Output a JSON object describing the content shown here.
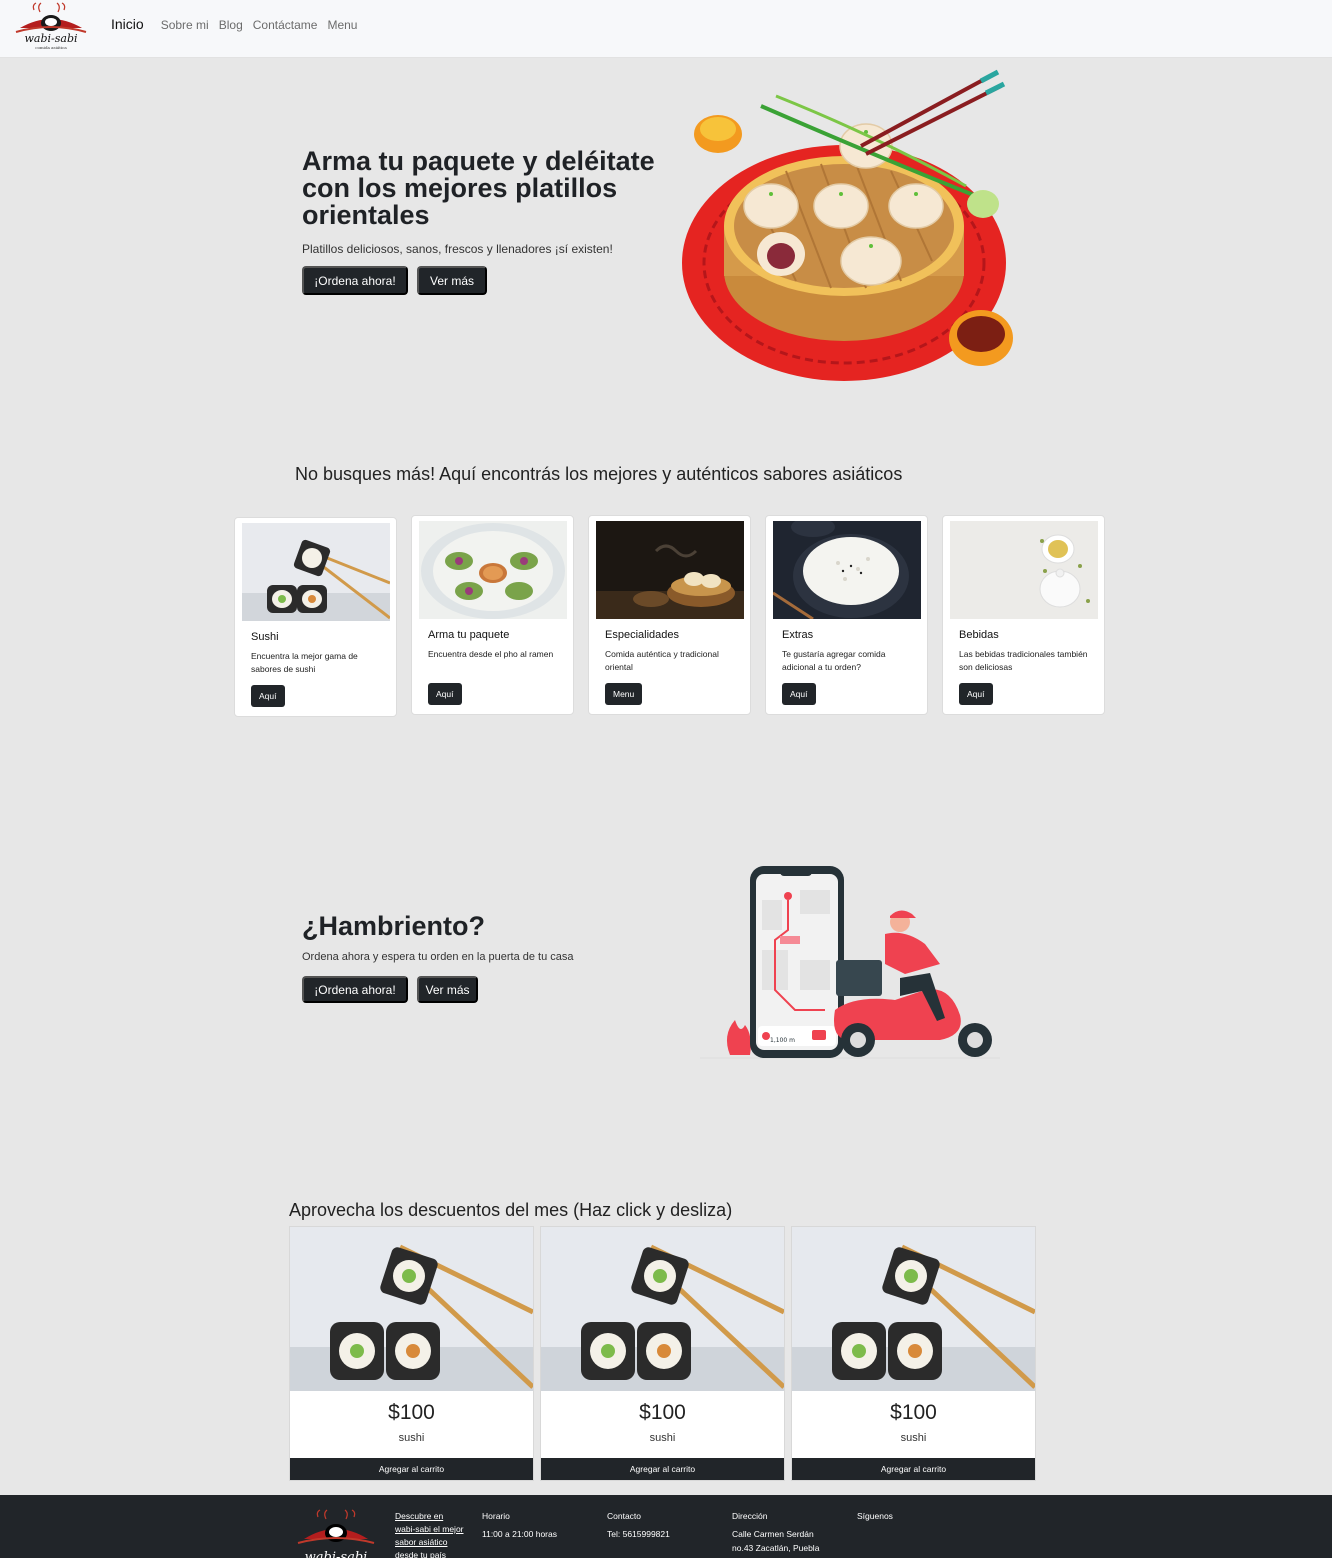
{
  "nav": {
    "logo_text": "wabi-sabi",
    "logo_sub": "comida asiática",
    "links": [
      "Inicio",
      "Sobre mi",
      "Blog",
      "Contáctame",
      "Menu"
    ]
  },
  "hero": {
    "title": "Arma tu paquete y deléitate con los mejores platillos orientales",
    "subtitle": "Platillos deliciosos, sanos, frescos y llenadores ¡sí existen!",
    "order_button": "¡Ordena ahora!",
    "more_button": "Ver más"
  },
  "categories": {
    "title": "No busques más! Aquí encontrás los mejores y auténticos sabores asiáticos",
    "cards": [
      {
        "title": "Sushi",
        "text": "Encuentra la mejor gama de sabores de sushi",
        "button": "Aquí"
      },
      {
        "title": "Arma tu paquete",
        "text": "Encuentra desde el pho al ramen",
        "button": "Aquí"
      },
      {
        "title": "Especialidades",
        "text": "Comida auténtica y tradicional oriental",
        "button": "Menu"
      },
      {
        "title": "Extras",
        "text": "Te gustaría agregar comida adicional a tu orden?",
        "button": "Aquí"
      },
      {
        "title": "Bebidas",
        "text": "Las bebidas tradicionales también son deliciosas",
        "button": "Aquí"
      }
    ]
  },
  "hungry": {
    "title": "¿Hambriento?",
    "subtitle": "Ordena ahora y espera tu orden en la puerta de tu casa",
    "order_button": "¡Ordena ahora!",
    "more_button": "Ver más",
    "phone_distance": "1,100 m"
  },
  "deals": {
    "title": "Aprovecha los descuentos del mes (Haz click y desliza)",
    "items": [
      {
        "price": "$100",
        "name": "sushi",
        "button": "Agregar al carrito"
      },
      {
        "price": "$100",
        "name": "sushi",
        "button": "Agregar al carrito"
      },
      {
        "price": "$100",
        "name": "sushi",
        "button": "Agregar al carrito"
      }
    ]
  },
  "footer": {
    "tagline": [
      "Descubre en",
      "wabi-sabi el mejor",
      "sabor asiático",
      "desde tu país"
    ],
    "schedule": {
      "heading": "Horario",
      "value": "11:00 a 21:00 horas"
    },
    "contact": {
      "heading": "Contacto",
      "value": "Tel: 5615999821"
    },
    "address": {
      "heading": "Dirección",
      "lines": [
        "Calle Carmen Serdán",
        "no.43 Zacatlán, Puebla"
      ]
    },
    "social": {
      "heading": "Síguenos"
    }
  },
  "colors": {
    "dark": "#212529",
    "background": "#e7e7e7",
    "accent_red": "#e52421"
  }
}
